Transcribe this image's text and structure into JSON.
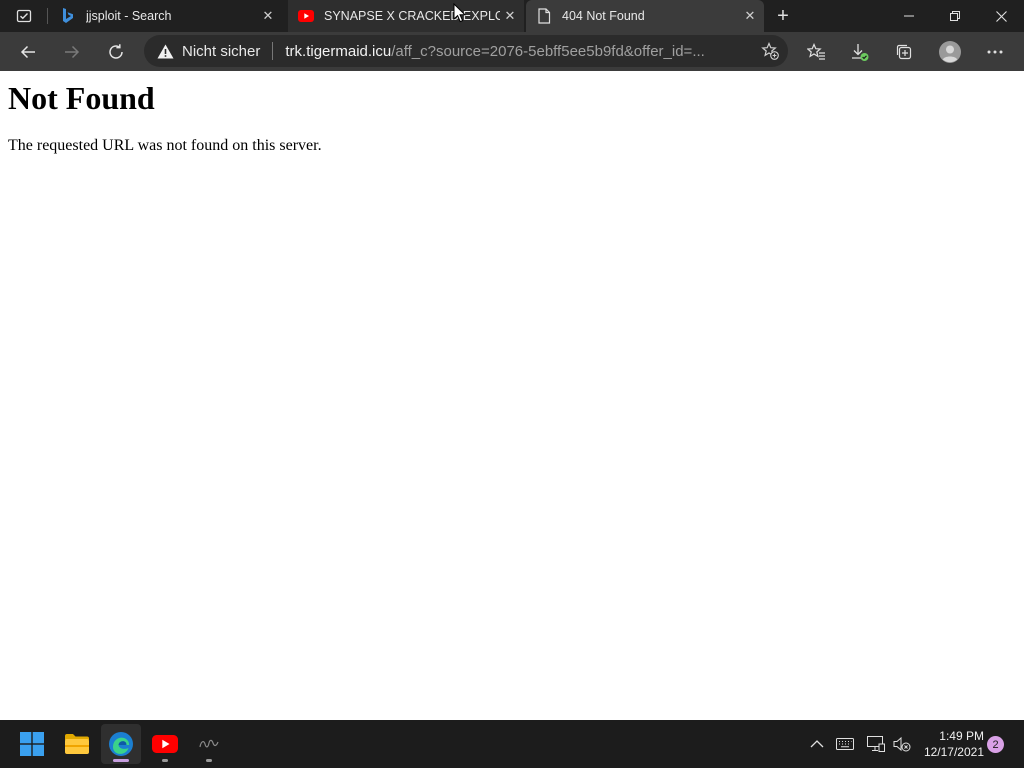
{
  "browser": {
    "tabs": [
      {
        "title": "jjsploit - Search",
        "favicon": "bing-icon"
      },
      {
        "title": "SYNAPSE X CRACKED EXPLOIT 🔥",
        "favicon": "youtube-icon"
      },
      {
        "title": "404 Not Found",
        "favicon": "page-icon",
        "active": true
      }
    ],
    "new_tab_label": "+",
    "address_bar": {
      "security_label": "Nicht sicher",
      "url_host": "trk.tigermaid.icu",
      "url_path": "/aff_c?source=2076-5ebff5ee5b9fd&offer_id=..."
    }
  },
  "page": {
    "heading": "Not Found",
    "message": "The requested URL was not found on this server."
  },
  "taskbar": {
    "apps": [
      "start-icon",
      "file-explorer-icon",
      "edge-icon",
      "youtube-icon",
      "app-icon"
    ],
    "time": "1:49 PM",
    "date": "12/17/2021",
    "notification_count": "2"
  },
  "colors": {
    "titlebar_bg": "#202020",
    "toolbar_bg": "#3b3b3b",
    "active_indicator": "#c79fe0",
    "youtube_red": "#ff0000",
    "notification_badge": "#d9a1e6"
  }
}
